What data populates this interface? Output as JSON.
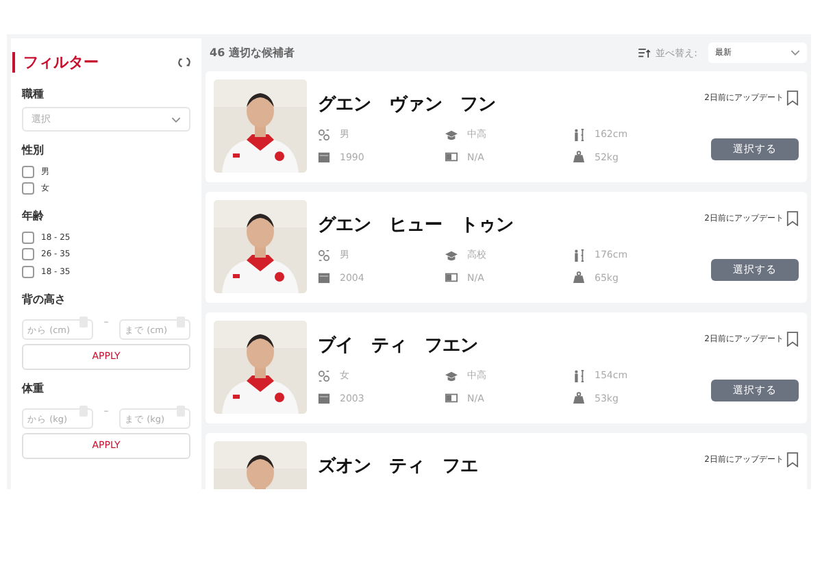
{
  "sidebar": {
    "title": "フィルター",
    "sections": [
      {
        "kind": "select",
        "label": "職種",
        "placeholder": "選択"
      },
      {
        "kind": "checks",
        "label": "性別",
        "options": [
          {
            "label": "男",
            "checked": false
          },
          {
            "label": "女",
            "checked": false
          }
        ]
      },
      {
        "kind": "checks",
        "label": "年齢",
        "options": [
          {
            "label": "18 - 25",
            "checked": false
          },
          {
            "label": "26 - 35",
            "checked": false
          },
          {
            "label": "18 - 35",
            "checked": false
          }
        ]
      },
      {
        "kind": "range",
        "label": "背の高さ",
        "from_placeholder": "から (cm)",
        "separator": "–",
        "to_placeholder": "まで (cm)",
        "apply": "APPLY"
      },
      {
        "kind": "range",
        "label": "体重",
        "from_placeholder": "から (kg)",
        "separator": "–",
        "to_placeholder": "まで (kg)",
        "apply": "APPLY"
      }
    ]
  },
  "header": {
    "count": "46 適切な候補者",
    "sort_label": "並べ替え:",
    "sort_value": "最新"
  },
  "candidates": [
    {
      "name": "グエン　ヴァン　フン",
      "updated": "2日前にアップデート",
      "bookmarked": false,
      "gender": "男",
      "education": "中高",
      "height": "162cm",
      "birth_year": "1990",
      "license": "N/A",
      "weight": "52kg",
      "action": "選択する"
    },
    {
      "name": "グエン　ヒュー　トゥン",
      "updated": "2日前にアップデート",
      "bookmarked": false,
      "gender": "男",
      "education": "高校",
      "height": "176cm",
      "birth_year": "2004",
      "license": "N/A",
      "weight": "65kg",
      "action": "選択する"
    },
    {
      "name": "ブイ　ティ　フエン",
      "updated": "2日前にアップデート",
      "bookmarked": false,
      "gender": "女",
      "education": "中高",
      "height": "154cm",
      "birth_year": "2003",
      "license": "N/A",
      "weight": "53kg",
      "action": "選択する"
    },
    {
      "name": "ズオン　ティ　フエ",
      "updated": "2日前にアップデート",
      "bookmarked": false
    }
  ]
}
